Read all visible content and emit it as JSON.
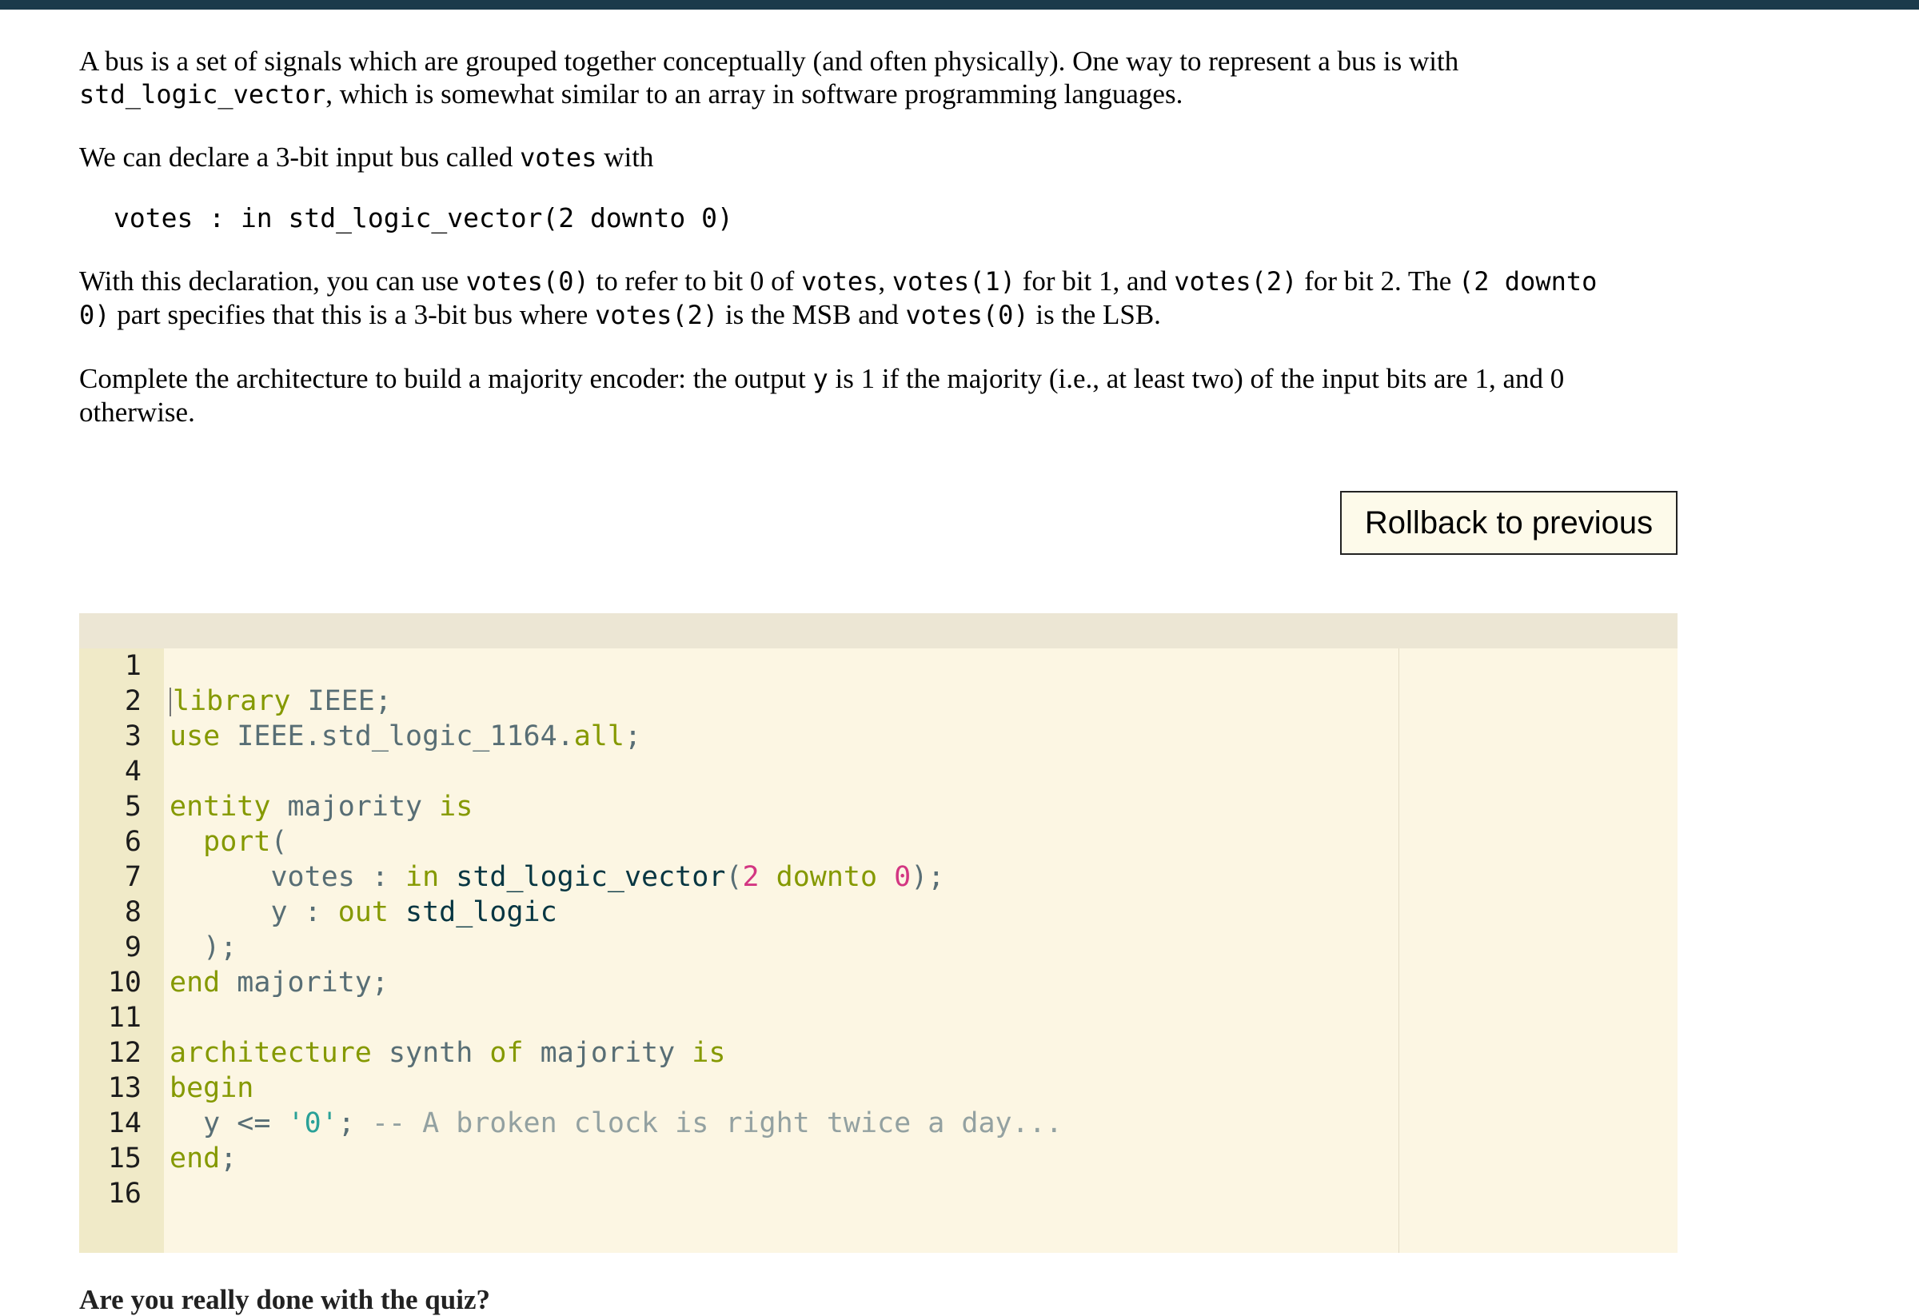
{
  "description": {
    "p1_a": "A bus is a set of signals which are grouped together conceptually (and often physically). One way to represent a bus is with",
    "p1_code": "std_logic_vector",
    "p1_b": ", which is somewhat similar to an array in software programming languages.",
    "p2_a": "We can declare a 3-bit input bus called",
    "p2_code": "votes",
    "p2_b": "with",
    "declaration": "votes : in std_logic_vector(2 downto 0)",
    "p3_a": "With this declaration, you can use",
    "p3_c1": "votes(0)",
    "p3_b": "to refer to bit 0 of",
    "p3_c2": "votes",
    "p3_sep": ",",
    "p3_c3": "votes(1)",
    "p3_c": "for bit 1, and",
    "p3_c4": "votes(2)",
    "p3_d": "for bit 2. The",
    "p3_c5": "(2 downto 0)",
    "p3_e": "part specifies that this is a 3-bit bus where",
    "p3_c6": "votes(2)",
    "p3_f": "is the MSB and",
    "p3_c7": "votes(0)",
    "p3_g": "is the LSB.",
    "p4_a": "Complete the architecture to build a majority encoder: the output",
    "p4_code": "y",
    "p4_b": "is 1 if the majority (i.e., at least two) of the input bits are 1, and 0 otherwise."
  },
  "rollback_label": "Rollback to previous",
  "editor": {
    "line_numbers": [
      "1",
      "2",
      "3",
      "4",
      "5",
      "6",
      "7",
      "8",
      "9",
      "10",
      "11",
      "12",
      "13",
      "14",
      "15",
      "16"
    ],
    "code": {
      "l1_kw": "library",
      "l1_rest": " IEEE;",
      "l2_kw": "use",
      "l2_id": " IEEE.std_logic_1164.",
      "l2_all": "all",
      "l2_end": ";",
      "l4_kw1": "entity",
      "l4_id": " majority ",
      "l4_kw2": "is",
      "l5_indent": "  ",
      "l5_kw": "port",
      "l5_rest": "(",
      "l6_indent": "      ",
      "l6_id": "votes : ",
      "l6_kw": "in",
      "l6_ty": " std_logic_vector",
      "l6_p": "(",
      "l6_n1": "2",
      "l6_kw2": " downto ",
      "l6_n2": "0",
      "l6_end": ");",
      "l7_indent": "      ",
      "l7_id": "y : ",
      "l7_kw": "out",
      "l7_ty": " std_logic",
      "l8_indent": "  ",
      "l8_rest": ");",
      "l9_kw": "end",
      "l9_rest": " majority;",
      "l11_kw1": "architecture",
      "l11_id1": " synth ",
      "l11_kw2": "of",
      "l11_id2": " majority ",
      "l11_kw3": "is",
      "l12_kw": "begin",
      "l13_indent": "  ",
      "l13_id": "y <= ",
      "l13_str": "'0'",
      "l13_semi": "; ",
      "l13_cmt": "-- A broken clock is right twice a day...",
      "l14_kw": "end",
      "l14_rest": ";"
    }
  },
  "cutoff_text": "Are you really done with the quiz?"
}
